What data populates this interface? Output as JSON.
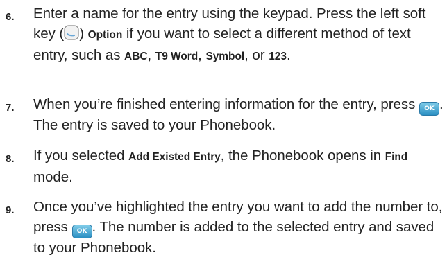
{
  "steps": [
    {
      "number": "6.",
      "parts": {
        "p1": "Enter a name for the entry using the keypad. Press the left soft key (",
        "p2": ") ",
        "option": "Option",
        "p3": " if you want to select a different method of text entry, such as ",
        "abc": "ABC",
        "sep1": ", ",
        "t9": "T9 Word",
        "sep2": ", ",
        "symbol": "Symbol",
        "p4": ", or ",
        "n123": "123",
        "p5": "."
      },
      "icon": "left-soft-key-icon"
    },
    {
      "number": "7.",
      "parts": {
        "p1": "When you’re finished entering information for the entry, press ",
        "ok": "OK",
        "p2": ". The entry is saved to your Phonebook."
      },
      "icon": "ok-key-icon"
    },
    {
      "number": "8.",
      "parts": {
        "p1": "If you selected ",
        "add_existed": "Add Existed Entry",
        "p2": ", the Phonebook opens in ",
        "find": "Find",
        "p3": " mode."
      }
    },
    {
      "number": "9.",
      "parts": {
        "p1": "Once you’ve highlighted the entry you want to add the number to, press ",
        "ok": "OK",
        "p2": ". The number is added to the selected entry and saved to your Phonebook."
      },
      "icon": "ok-key-icon"
    }
  ],
  "colors": {
    "text": "#222222",
    "ok_key_top": "#7fcbe8",
    "ok_key_bottom": "#2b8fc2"
  }
}
